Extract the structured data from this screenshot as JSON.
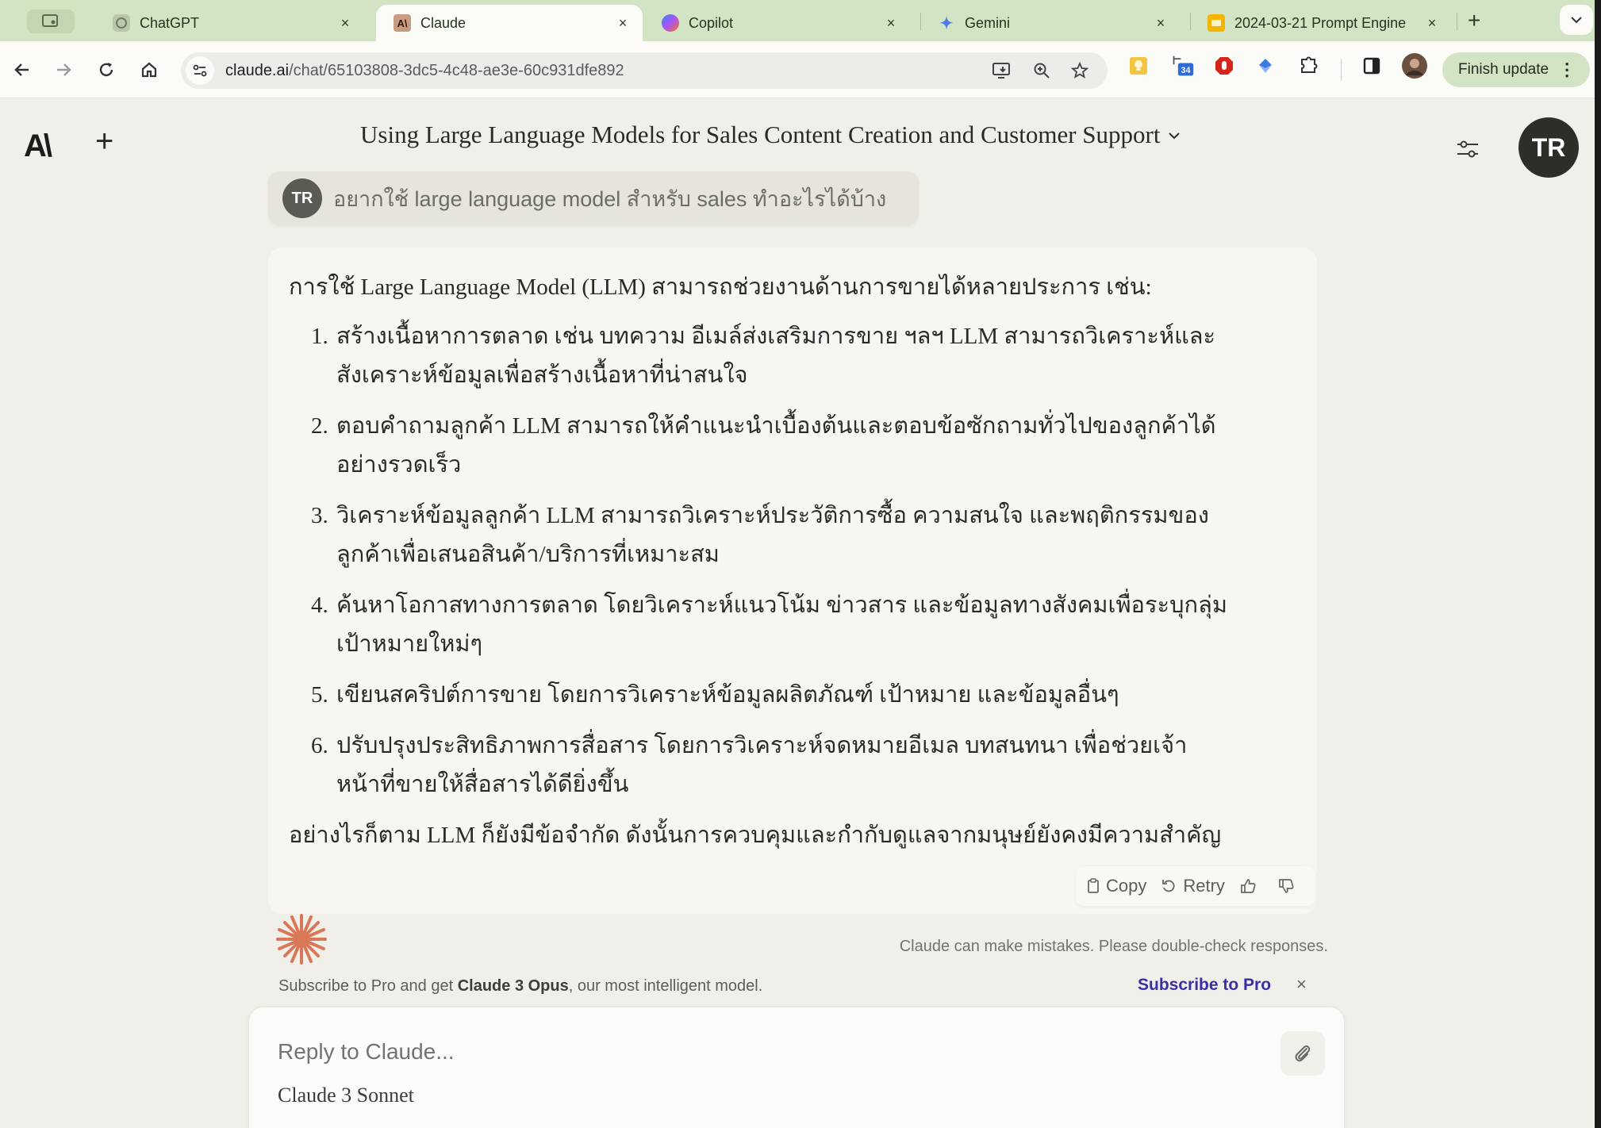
{
  "browser": {
    "tabs": [
      {
        "title": "ChatGPT",
        "icon": "chatgpt-icon",
        "active": false
      },
      {
        "title": "Claude",
        "icon": "claude-icon",
        "active": true
      },
      {
        "title": "Copilot",
        "icon": "copilot-icon",
        "active": false
      },
      {
        "title": "Gemini",
        "icon": "gemini-icon",
        "active": false
      },
      {
        "title": "2024-03-21 Prompt Engine",
        "icon": "slides-icon",
        "active": false
      }
    ],
    "tab_close_glyph": "×",
    "new_tab_glyph": "+",
    "tab_list_glyph": "⌄",
    "url_host": "claude.ai",
    "url_path": "/chat/65103808-3dc5-4c48-ae3e-60c931dfe892",
    "extension_badge": "34",
    "finish_update_label": "Finish update",
    "kebab_glyph": "⋮"
  },
  "app": {
    "logo_text": "A\\",
    "new_chat_glyph": "+",
    "chat_title": "Using Large Language Models for Sales Content Creation and Customer Support",
    "title_chevron": "⌄",
    "user_initials": "TR",
    "accent_color": "#d97757",
    "link_color": "#3b2fa5"
  },
  "conversation": {
    "user_message": {
      "initials": "TR",
      "text": "อยากใช้ large language model สำหรับ sales ทำอะไรได้บ้าง"
    },
    "assistant_message": {
      "intro": "การใช้ Large Language Model (LLM) สามารถช่วยงานด้านการขายได้หลายประการ เช่น:",
      "items": [
        {
          "num": "1.",
          "text": "สร้างเนื้อหาการตลาด เช่น บทความ อีเมล์ส่งเสริมการขาย ฯลฯ LLM สามารถวิเคราะห์และสังเคราะห์ข้อมูลเพื่อสร้างเนื้อหาที่น่าสนใจ"
        },
        {
          "num": "2.",
          "text": "ตอบคำถามลูกค้า LLM สามารถให้คำแนะนำเบื้องต้นและตอบข้อซักถามทั่วไปของลูกค้าได้อย่างรวดเร็ว"
        },
        {
          "num": "3.",
          "text": "วิเคราะห์ข้อมูลลูกค้า LLM สามารถวิเคราะห์ประวัติการซื้อ ความสนใจ และพฤติกรรมของลูกค้าเพื่อเสนอสินค้า/บริการที่เหมาะสม"
        },
        {
          "num": "4.",
          "text": "ค้นหาโอกาสทางการตลาด โดยวิเคราะห์แนวโน้ม ข่าวสาร และข้อมูลทางสังคมเพื่อระบุกลุ่มเป้าหมายใหม่ๆ"
        },
        {
          "num": "5.",
          "text": "เขียนสคริปต์การขาย โดยการวิเคราะห์ข้อมูลผลิตภัณฑ์ เป้าหมาย และข้อมูลอื่นๆ"
        },
        {
          "num": "6.",
          "text": "ปรับปรุงประสิทธิภาพการสื่อสาร โดยการวิเคราะห์จดหมายอีเมล บทสนทนา เพื่อช่วยเจ้าหน้าที่ขายให้สื่อสารได้ดียิ่งขึ้น"
        }
      ],
      "outro": "อย่างไรก็ตาม LLM ก็ยังมีข้อจำกัด ดังนั้นการควบคุมและกำกับดูแลจากมนุษย์ยังคงมีความสำคัญ"
    },
    "actions": {
      "copy": "Copy",
      "retry": "Retry"
    },
    "disclaimer": "Claude can make mistakes. Please double-check responses."
  },
  "promo": {
    "prefix": "Subscribe to Pro and get ",
    "model": "Claude 3 Opus",
    "suffix": ", our most intelligent model.",
    "link": "Subscribe to Pro",
    "close_glyph": "×"
  },
  "composer": {
    "placeholder": "Reply to Claude...",
    "value": "",
    "model": "Claude 3 Sonnet"
  }
}
